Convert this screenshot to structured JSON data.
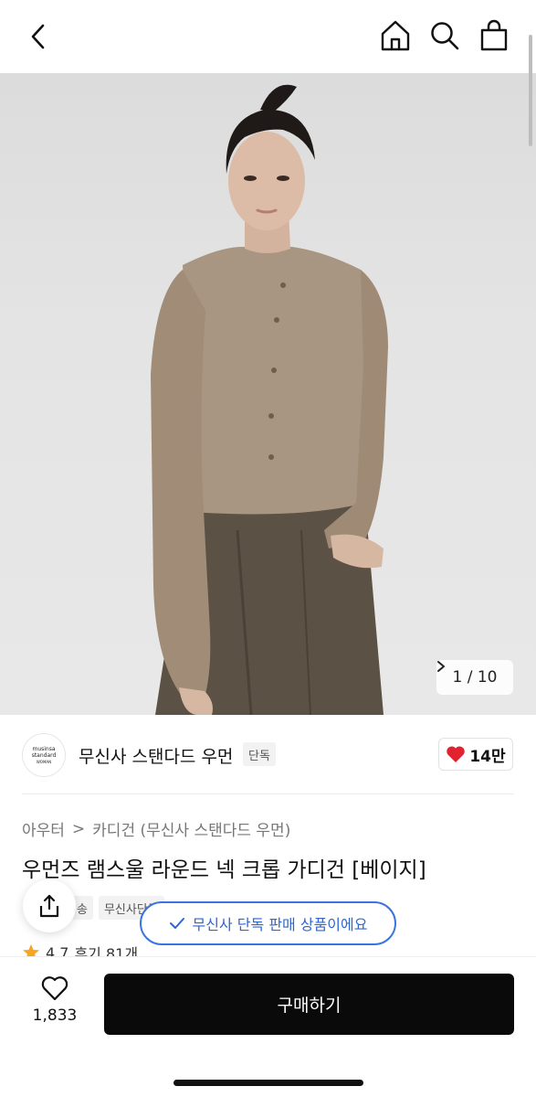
{
  "header": {
    "back_icon": "chevron-left-icon",
    "home_icon": "home-icon",
    "search_icon": "search-icon",
    "bag_icon": "shopping-bag-icon"
  },
  "gallery": {
    "counter_text": "1 / 10",
    "counter_icon": "chevron-right-icon",
    "current_index": 1,
    "total": 10
  },
  "brand": {
    "logo_line1": "musinsa",
    "logo_line2": "standard",
    "logo_line3": "WOMAN",
    "name": "무신사 스탠다드 우먼",
    "badge": "단독",
    "like_count": "14만",
    "like_icon": "heart-filled-icon",
    "like_color": "#e0232e"
  },
  "breadcrumb": {
    "category": "아우터",
    "separator": ">",
    "subcategory": "카디건 (무신사 스탠다드 우먼)"
  },
  "product": {
    "title": "우먼즈 램스울 라운드 넥 크롭 가디건 [베이지]",
    "tags": [
      "송",
      "무신사단독"
    ]
  },
  "toast": {
    "icon": "check-icon",
    "text": "무신사 단독 판매 상품이에요"
  },
  "rating": {
    "icon": "star-icon",
    "value": "4.7",
    "reviews": "후기 81개"
  },
  "bottom": {
    "wish_icon": "heart-outline-icon",
    "wish_count": "1,833",
    "buy_label": "구매하기",
    "share_icon": "share-icon"
  },
  "colors": {
    "accent_blue": "#2f66d0",
    "buy_button": "#0a0a0a",
    "heart_red": "#e0232e"
  }
}
